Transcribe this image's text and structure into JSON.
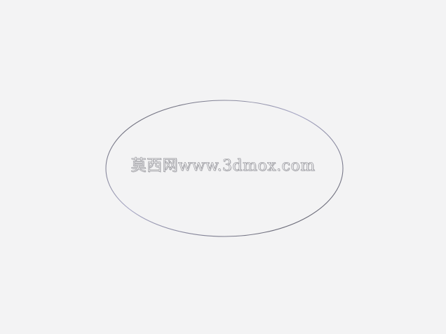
{
  "watermark": {
    "text": "莫西网www.3dmox.com"
  },
  "colors": {
    "background": "#f3f3f4",
    "ellipse_stroke_dark": "#5a5a62",
    "ellipse_stroke_light": "#a9a9c6",
    "watermark_outline": "#8d8d93"
  }
}
